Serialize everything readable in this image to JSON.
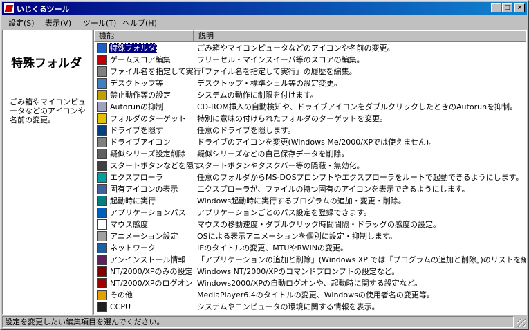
{
  "window": {
    "title": "いじくるツール"
  },
  "menu": [
    "設定(S)",
    "表示(V)",
    "ツール(T)",
    "ヘルプ(H)"
  ],
  "left": {
    "title": "特殊フォルダ",
    "description": "ごみ箱やマイコンピュータなどのアイコンや名前の変更。"
  },
  "list": {
    "headers": [
      "機能",
      "説明"
    ],
    "items": [
      {
        "name": "特殊フォルダ",
        "desc": "ごみ箱やマイコンピュータなどのアイコンや名前の変更。",
        "icon": "folder-blue-icon",
        "color": "#2060c0",
        "selected": true
      },
      {
        "name": "ゲームスコア編集",
        "desc": "フリーセル・マインスイーパ等のスコアの編集。",
        "icon": "dice-icon",
        "color": "#c00000"
      },
      {
        "name": "ファイル名を指定して実行",
        "desc": "「ファイル名を指定して実行」の履歴を編集。",
        "icon": "run-icon",
        "color": "#808080"
      },
      {
        "name": "デスクトップ等",
        "desc": "デスクトップ・標準シェル等の設定変更。",
        "icon": "desktop-icon",
        "color": "#4080c0"
      },
      {
        "name": "禁止動作等の設定",
        "desc": "システムの動作に制限を付けます。",
        "icon": "gear-icon",
        "color": "#c0a000"
      },
      {
        "name": "Autorunの抑制",
        "desc": "CD-ROM挿入の自動検知や、ドライブアイコンをダブルクリックしたときのAutorunを抑制。",
        "icon": "cdrom-icon",
        "color": "#a0a0c0"
      },
      {
        "name": "フォルダのターゲット",
        "desc": "特別に意味の付けられたフォルダのターゲットを変更。",
        "icon": "folder-yellow-icon",
        "color": "#e0c000"
      },
      {
        "name": "ドライブを隠す",
        "desc": "任意のドライブを隠します。",
        "icon": "floppy-icon",
        "color": "#004080"
      },
      {
        "name": "ドライブアイコン",
        "desc": "ドライブのアイコンを変更(Windows Me/2000/XPでは使えません)。",
        "icon": "drive-icon",
        "color": "#808080"
      },
      {
        "name": "疑似シリーズ設定削除",
        "desc": "疑似シリーズなどの自己保存データを削除。",
        "icon": "delete-icon",
        "color": "#606060"
      },
      {
        "name": "スタートボタンなどを隠す",
        "desc": "スタートボタンやタスクバー等の隠蔽・無効化。",
        "icon": "start-button-icon",
        "color": "#404040"
      },
      {
        "name": "エクスプローラ",
        "desc": "任意のフォルダからMS-DOSプロンプトやエクスプローラをルートで起動できるようにします。",
        "icon": "explorer-icon",
        "color": "#00a0a0"
      },
      {
        "name": "固有アイコンの表示",
        "desc": "エクスプローラが、ファイルの持つ固有のアイコンを表示できるようにします。",
        "icon": "list-icon",
        "color": "#4060a0"
      },
      {
        "name": "起動時に実行",
        "desc": "Windows起動時に実行するプログラムの追加・変更・削除。",
        "icon": "startup-icon",
        "color": "#008080"
      },
      {
        "name": "アプリケーションパス",
        "desc": "アプリケーションごとのパス設定を登録できます。",
        "icon": "app-path-icon",
        "color": "#0060c0"
      },
      {
        "name": "マウス感度",
        "desc": "マウスの移動速度・ダブルクリック時間間隔・ドラッグの感度の設定。",
        "icon": "mouse-icon",
        "color": "#ffffff"
      },
      {
        "name": "アニメーション設定",
        "desc": "OSによる表示アニメーションを個別に設定・抑制します。",
        "icon": "animation-icon",
        "color": "#a0a0a0"
      },
      {
        "name": "ネットワーク",
        "desc": "IEのタイトルの変更、MTUやRWINの変更。",
        "icon": "network-icon",
        "color": "#2060a0"
      },
      {
        "name": "アンインストール情報",
        "desc": "「アプリケーションの追加と削除」(Windows XP では「プログラムの追加と削除」)のリストを編集します。",
        "icon": "uninstall-icon",
        "color": "#602060"
      },
      {
        "name": "NT/2000/XPのみの設定",
        "desc": "Windows NT/2000/XPのコマンドプロンプトの設定など。",
        "icon": "nt-settings-icon",
        "color": "#800000"
      },
      {
        "name": "NT/2000/XPのログオン",
        "desc": "Windows2000/XPの自動ログオンや、起動時に関する設定など。",
        "icon": "nt-logon-icon",
        "color": "#a00000"
      },
      {
        "name": "その他",
        "desc": "MediaPlayer6.4のタイトルの変更、Windowsの使用者名の変更等。",
        "icon": "misc-icon",
        "color": "#e0a000"
      },
      {
        "name": "CCPU",
        "desc": "システムやコンピュータの環境に関する情報を表示。",
        "icon": "cpu-icon",
        "color": "#202020"
      }
    ]
  },
  "status": "設定を変更したい編集項目を選んでください。"
}
